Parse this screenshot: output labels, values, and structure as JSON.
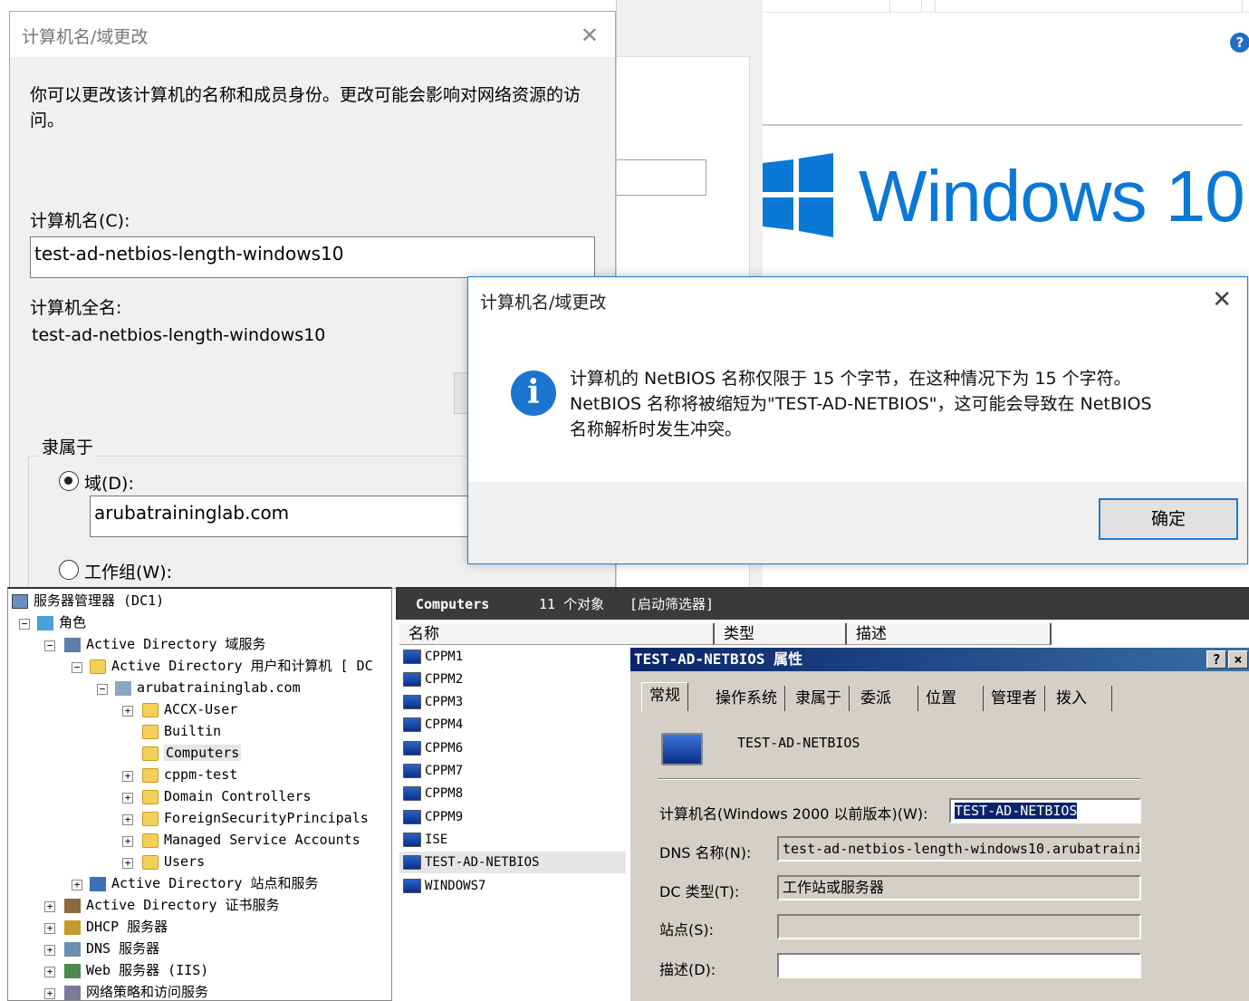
{
  "main_dialog": {
    "title": "计算机名/域更改",
    "description": "你可以更改该计算机的名称和成员身份。更改可能会影响对网络资源的访问。",
    "computer_name_label": "计算机名(C):",
    "computer_name_value": "test-ad-netbios-length-windows10",
    "full_name_label": "计算机全名:",
    "full_name_value": "test-ad-netbios-length-windows10",
    "member_of_label": "隶属于",
    "domain_label": "域(D):",
    "domain_value": "arubatraininglab.com",
    "workgroup_label": "工作组(W):"
  },
  "background": {
    "logo_text": "Windows 10",
    "help_icon_label": "?"
  },
  "message_box": {
    "title": "计算机名/域更改",
    "icon_label": "i",
    "line1": "计算机的 NetBIOS 名称仅限于 15 个字节，在这种情况下为 15 个字符。",
    "line2": "NetBIOS 名称将被缩短为\"TEST-AD-NETBIOS\"，这可能会导致在 NetBIOS",
    "line3": "名称解析时发生冲突。",
    "ok_label": "确定"
  },
  "tree": {
    "items": [
      {
        "label": "服务器管理器 (DC1)"
      },
      {
        "label": "角色"
      },
      {
        "label": "Active Directory 域服务"
      },
      {
        "label": "Active Directory 用户和计算机 [ DC"
      },
      {
        "label": "arubatraininglab.com"
      },
      {
        "label": "ACCX-User"
      },
      {
        "label": "Builtin"
      },
      {
        "label": "Computers"
      },
      {
        "label": "cppm-test"
      },
      {
        "label": "Domain Controllers"
      },
      {
        "label": "ForeignSecurityPrincipals"
      },
      {
        "label": "Managed Service Accounts"
      },
      {
        "label": "Users"
      },
      {
        "label": "Active Directory 站点和服务"
      },
      {
        "label": "Active Directory 证书服务"
      },
      {
        "label": "DHCP 服务器"
      },
      {
        "label": "DNS 服务器"
      },
      {
        "label": "Web 服务器 (IIS)"
      },
      {
        "label": "网络策略和访问服务"
      }
    ]
  },
  "list_pane": {
    "header_title": "Computers",
    "header_count": "11 个对象",
    "header_filter": "[启动筛选器]",
    "columns": [
      "名称",
      "类型",
      "描述"
    ],
    "rows": [
      "CPPM1",
      "CPPM2",
      "CPPM3",
      "CPPM4",
      "CPPM6",
      "CPPM7",
      "CPPM8",
      "CPPM9",
      "ISE",
      "TEST-AD-NETBIOS",
      "WINDOWS7"
    ]
  },
  "properties": {
    "title": "TEST-AD-NETBIOS 属性",
    "help_btn": "?",
    "close_btn": "×",
    "tabs": [
      "常规",
      "操作系统",
      "隶属于",
      "委派",
      "位置",
      "管理者",
      "拨入"
    ],
    "object_name": "TEST-AD-NETBIOS",
    "prewin_label": "计算机名(Windows 2000 以前版本)(W):",
    "prewin_value": "TEST-AD-NETBIOS",
    "dns_label": "DNS 名称(N):",
    "dns_value": "test-ad-netbios-length-windows10.arubatraini",
    "dc_type_label": "DC 类型(T):",
    "dc_type_value": "工作站或服务器",
    "site_label": "站点(S):",
    "site_value": "",
    "desc_label": "描述(D):",
    "desc_value": ""
  },
  "colors": {
    "accent": "#1a7bd4",
    "windows_blue": "#0a78d7",
    "title_bar": "#0a246a"
  }
}
